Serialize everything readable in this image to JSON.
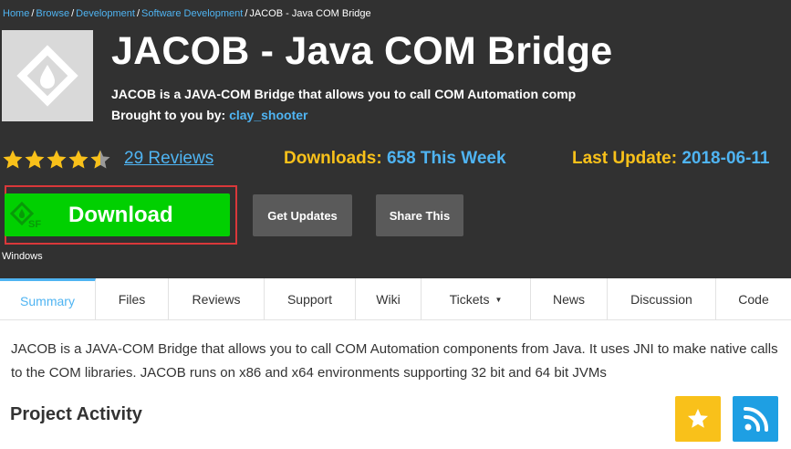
{
  "breadcrumb": {
    "items": [
      "Home",
      "Browse",
      "Development",
      "Software Development"
    ],
    "current": "JACOB - Java COM Bridge"
  },
  "project": {
    "title": "JACOB - Java COM Bridge",
    "summary": "JACOB is a JAVA-COM Bridge that allows you to call COM Automation comp",
    "brought_label": "Brought to you by:",
    "author": "clay_shooter",
    "logo_icon": "sourceforge-diamond-icon"
  },
  "stats": {
    "rating": 4.5,
    "reviews": "29 Reviews",
    "downloads_label": "Downloads:",
    "downloads_value": "658 This Week",
    "last_update_label": "Last Update:",
    "last_update_value": "2018-06-11"
  },
  "actions": {
    "download": "Download",
    "get_updates": "Get Updates",
    "share_this": "Share This",
    "platform": "Windows"
  },
  "tabs": [
    {
      "label": "Summary",
      "active": true
    },
    {
      "label": "Files"
    },
    {
      "label": "Reviews"
    },
    {
      "label": "Support"
    },
    {
      "label": "Wiki"
    },
    {
      "label": "Tickets",
      "dropdown": true
    },
    {
      "label": "News"
    },
    {
      "label": "Discussion"
    },
    {
      "label": "Code"
    }
  ],
  "description": "JACOB is a JAVA-COM Bridge that allows you to call COM Automation components from Java. It uses JNI to make native calls to the COM libraries. JACOB runs on x86 and x64 environments supporting 32 bit and 64 bit JVMs",
  "activity": {
    "heading": "Project Activity",
    "icons": [
      "star-icon",
      "rss-icon"
    ]
  },
  "colors": {
    "header_bg": "#313131",
    "link_blue": "#4fb4f2",
    "gold": "#f9c11a",
    "download_green": "#01d001",
    "highlight_red": "#d9383a",
    "rss_blue": "#1e9fe3"
  }
}
